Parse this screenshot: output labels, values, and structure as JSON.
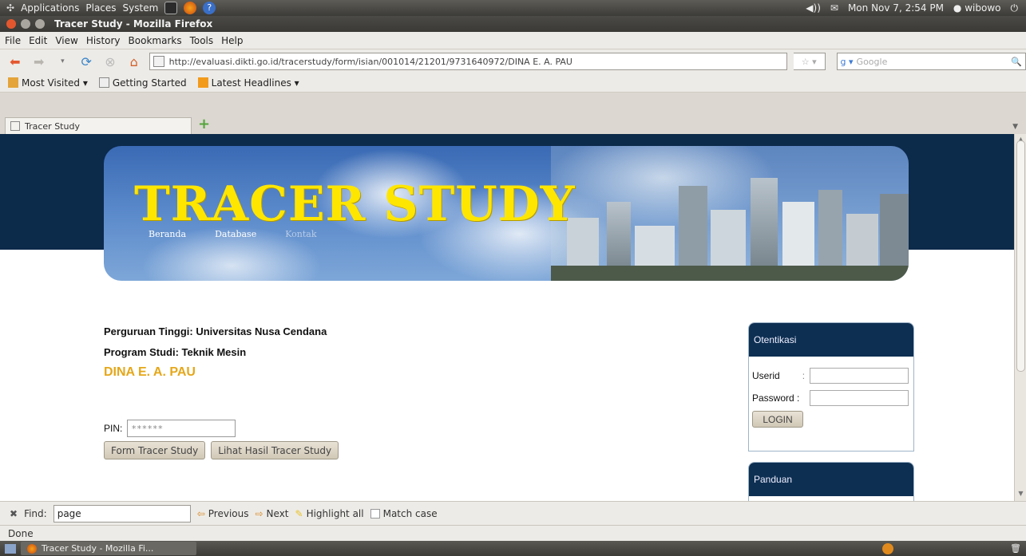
{
  "gnome_panel": {
    "menus": [
      "Applications",
      "Places",
      "System"
    ],
    "clock": "Mon Nov  7,  2:54 PM",
    "user": "wibowo"
  },
  "window": {
    "title": "Tracer Study - Mozilla Firefox"
  },
  "menubar": [
    "File",
    "Edit",
    "View",
    "History",
    "Bookmarks",
    "Tools",
    "Help"
  ],
  "navbar": {
    "url": "http://evaluasi.dikti.go.id/tracerstudy/form/isian/001014/21201/9731640972/DINA E. A. PAU",
    "search_placeholder": "Google"
  },
  "bookmarks": [
    "Most Visited ▾",
    "Getting Started",
    "Latest Headlines ▾"
  ],
  "tab": {
    "title": "Tracer Study"
  },
  "page": {
    "banner_title": "TRACER STUDY",
    "nav": [
      "Beranda",
      "Database",
      "Kontak"
    ],
    "perguruan_tinggi": "Perguruan Tinggi: Universitas Nusa Cendana",
    "program_studi": "Program Studi: Teknik Mesin",
    "student_name": "DINA E. A. PAU",
    "pin_label": "PIN:",
    "pin_value": "******",
    "form_button": "Form Tracer Study",
    "results_button": "Lihat Hasil Tracer Study"
  },
  "sidebar": {
    "auth_title": "Otentikasi",
    "userid_label": "Userid",
    "password_label": "Password",
    "login_button": "LOGIN",
    "guide_title": "Panduan"
  },
  "findbar": {
    "label": "Find:",
    "value": "page",
    "previous": "Previous",
    "next": "Next",
    "highlight": "Highlight all",
    "match_case": "Match case"
  },
  "status": "Done",
  "taskbar": {
    "item": "Tracer Study - Mozilla Fi..."
  }
}
